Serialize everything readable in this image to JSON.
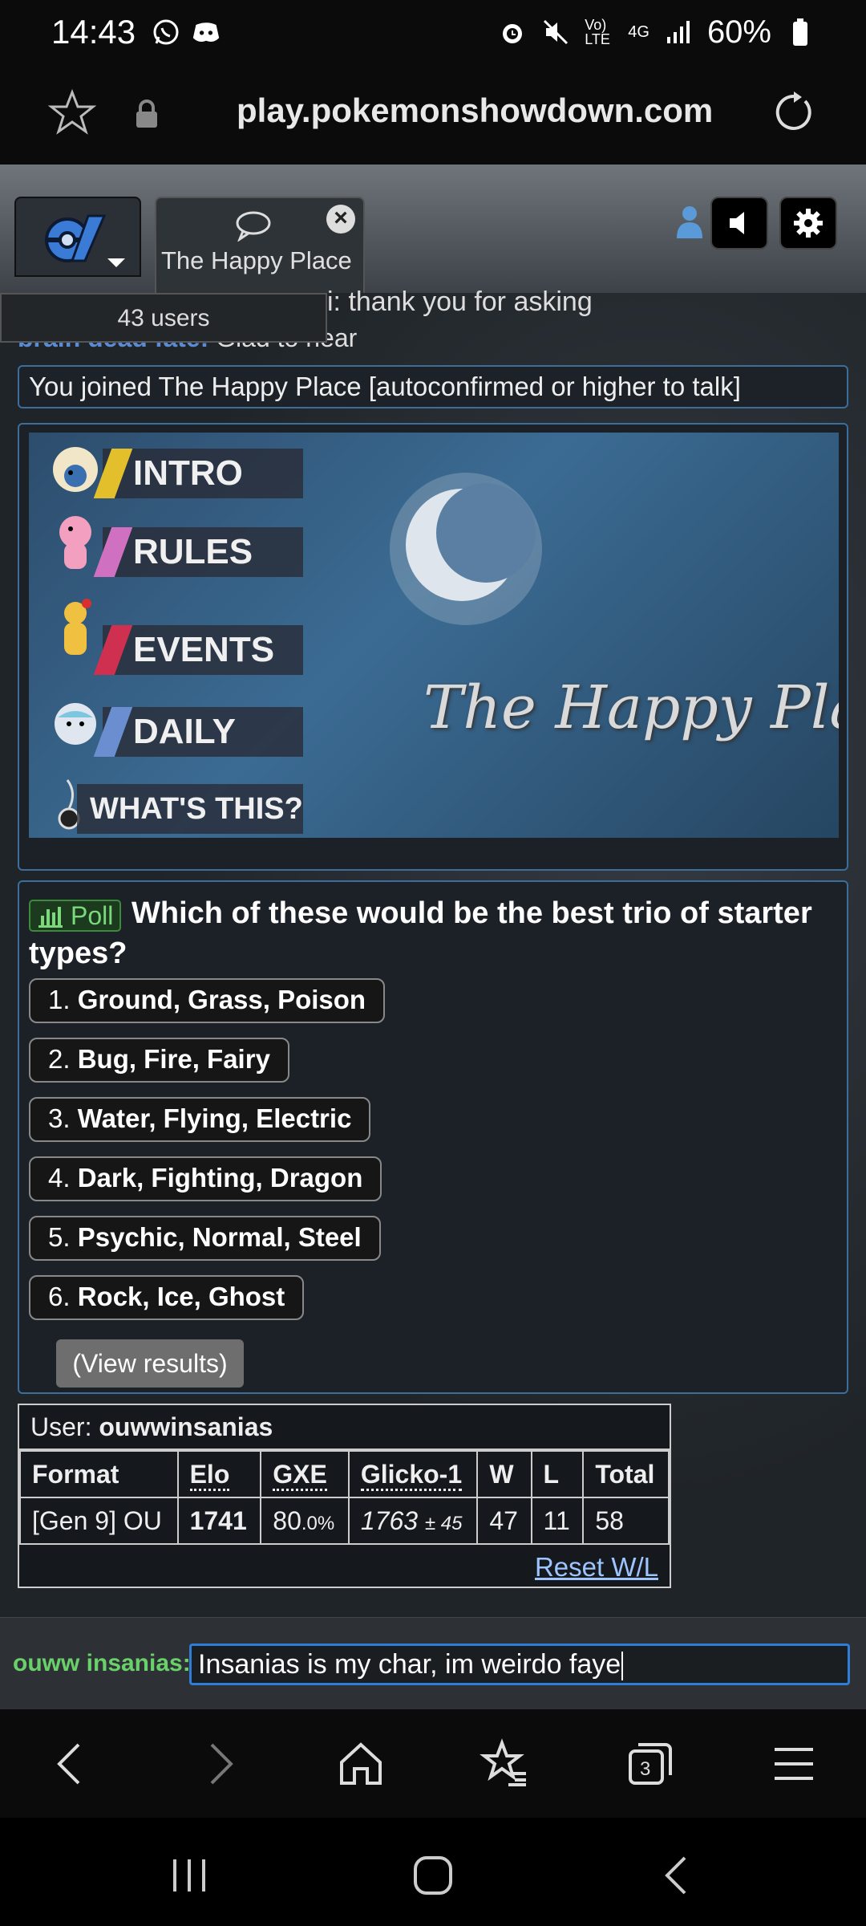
{
  "status_bar": {
    "time": "14:43",
    "network_label": "Vo) LTE",
    "network_type": "4G",
    "battery": "60%"
  },
  "browser": {
    "url": "play.pokemonshowdown.com"
  },
  "header": {
    "room_tab_label": "The Happy Place",
    "accent": "#2e7dd6"
  },
  "chat": {
    "users_count": "43 users",
    "partial_line_1": "i: thank you for asking",
    "partial_line_2_name": "brain dead fate:",
    "partial_line_2_text": "Glad to hear",
    "joined_message": "You joined The Happy Place [autoconfirmed or higher to talk]"
  },
  "banner": {
    "buttons": [
      "INTRO",
      "RULES",
      "EVENTS",
      "DAILY",
      "WHAT'S THIS?"
    ],
    "title": "The Happy Plac"
  },
  "poll": {
    "tag": "Poll",
    "question": "Which of these would be the best trio of starter types?",
    "options": [
      {
        "num": "1.",
        "text": "Ground, Grass, Poison"
      },
      {
        "num": "2.",
        "text": "Bug, Fire, Fairy"
      },
      {
        "num": "3.",
        "text": "Water, Flying, Electric"
      },
      {
        "num": "4.",
        "text": "Dark, Fighting, Dragon"
      },
      {
        "num": "5.",
        "text": "Psychic, Normal, Steel"
      },
      {
        "num": "6.",
        "text": "Rock, Ice, Ghost"
      }
    ],
    "view_results": "(View results)"
  },
  "rank": {
    "user_label": "User:",
    "username": "ouwwinsanias",
    "headers": [
      "Format",
      "Elo",
      "GXE",
      "Glicko-1",
      "W",
      "L",
      "Total"
    ],
    "row": {
      "format": "[Gen 9] OU",
      "elo": "1741",
      "gxe_main": "80",
      "gxe_dec": ".0%",
      "glicko": "1763",
      "glicko_dev": "± 45",
      "w": "47",
      "l": "11",
      "total": "58"
    },
    "reset": "Reset W/L"
  },
  "chat_input": {
    "name": "ouww insanias:",
    "value": "Insanias is my char, im weirdo faye"
  }
}
